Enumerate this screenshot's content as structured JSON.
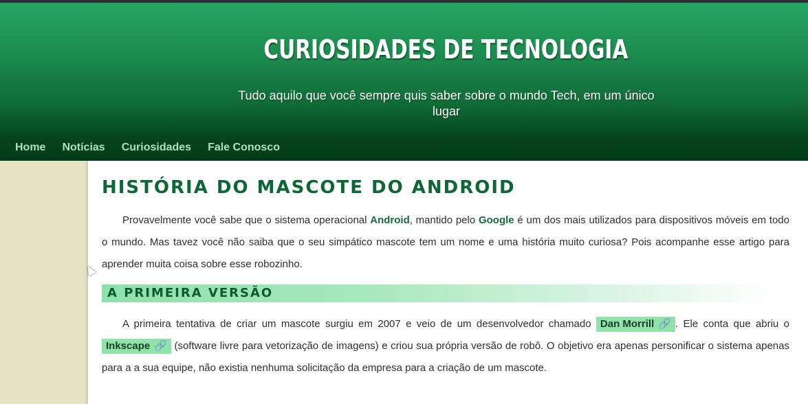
{
  "site": {
    "title": "CURIOSIDADES DE TECNOLOGIA",
    "tagline": "Tudo aquilo que você sempre quis saber sobre o mundo Tech, em um único lugar"
  },
  "nav": {
    "items": [
      {
        "label": "Home"
      },
      {
        "label": "Notícias"
      },
      {
        "label": "Curiosidades"
      },
      {
        "label": "Fale Conosco"
      }
    ]
  },
  "post": {
    "title": "História do mascote do Android",
    "intro": {
      "t1": "Provavelmente você sabe que o sistema operacional ",
      "android": "Android",
      "t2": ", mantido pelo ",
      "google": "Google",
      "t3": " é um dos mais utilizados para dispositivos móveis em todo o mundo. Mas tavez você não saiba que o seu simpático mascote tem um nome e uma história muito curiosa? Pois acompanhe esse artigo para aprender muita coisa sobre esse robozinho."
    },
    "section": {
      "heading": "A primeira versão",
      "t1": "A primeira tentativa de criar um mascote surgiu em 2007 e veio de um desenvolvedor chamado ",
      "link1": "Dan Morrill",
      "t2": ". Ele conta que abriu o ",
      "link2": "Inkscape",
      "t3": " (software livre para vetorização de imagens) e criou sua própria versão de robô. O objetivo era apenas personificar o sistema apenas para a a sua equipe, não existia nenhuma solicitação da empresa para a criação de um mascote."
    }
  },
  "icons": {
    "link": "link-icon",
    "cursor": "mouse-cursor-icon"
  },
  "colors": {
    "header_top": "#27a663",
    "header_bottom": "#033a19",
    "nav_text": "#a8e4b8",
    "title_green": "#0d6634",
    "link_bg": "#8fe3aa"
  }
}
